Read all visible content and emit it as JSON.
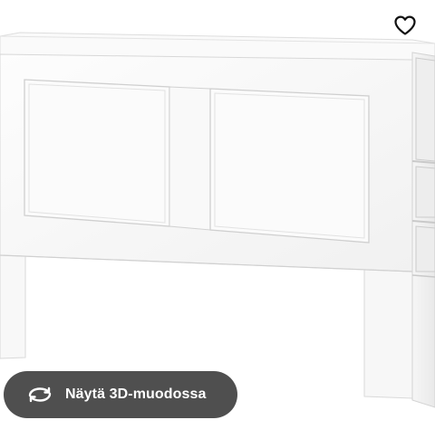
{
  "product": {
    "image_alt": "white headboard with shelves"
  },
  "favorite": {
    "icon": "heart-outline-icon"
  },
  "view_3d": {
    "icon": "rotate-3d-icon",
    "label": "Näytä 3D-muodossa"
  },
  "colors": {
    "button_bg": "#484848",
    "button_text": "#ffffff",
    "furniture_white": "#fbfbfb",
    "outline_gray": "#d6d6d6"
  }
}
